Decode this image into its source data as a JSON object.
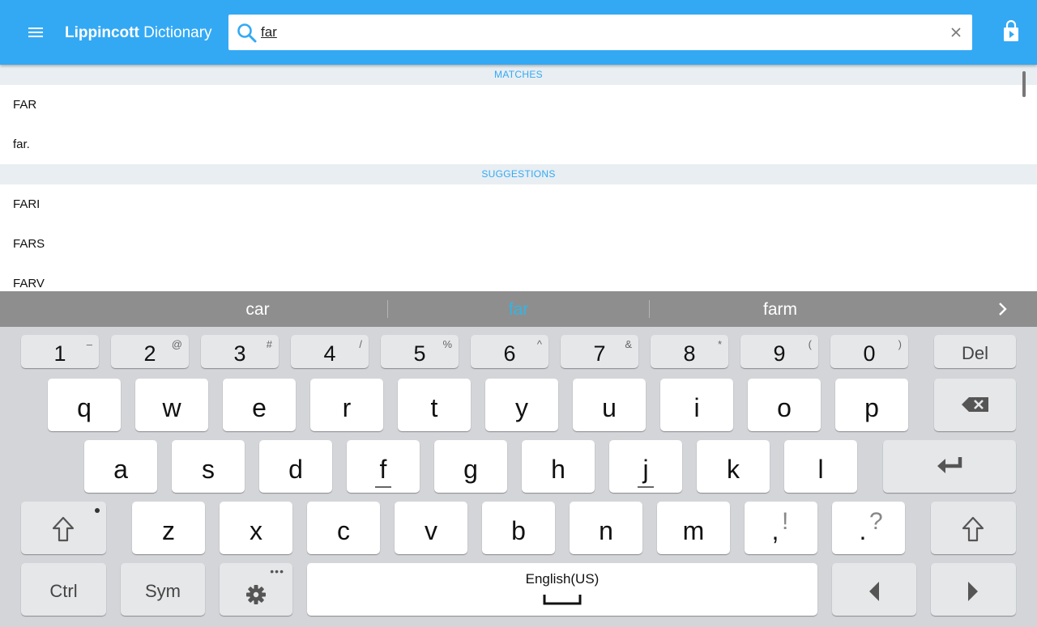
{
  "app": {
    "title_bold": "Lippincott",
    "title_regular": " Dictionary"
  },
  "search": {
    "value": "far",
    "placeholder": ""
  },
  "colors": {
    "appbar": "#33a9f4",
    "accent": "#33a9f4",
    "section_bg": "#e8eef2",
    "suggest_bg": "#8e8e8e",
    "suggest_active": "#33b5e5",
    "keyboard_bg": "#d3d5d9"
  },
  "icons": {
    "menu": "menu-icon",
    "search": "search-icon",
    "clear": "close-icon",
    "store": "store-bag-icon",
    "suggest_more": "chevron-right-icon"
  },
  "results": {
    "matches_header": "MATCHES",
    "matches": [
      "FAR",
      "far."
    ],
    "suggestions_header": "SUGGESTIONS",
    "suggestions": [
      "FARI",
      "FARS",
      "FARV"
    ]
  },
  "keyboard": {
    "suggestions": [
      "car",
      "far",
      "farm"
    ],
    "active_suggestion": "far",
    "number_row": [
      {
        "main": "1",
        "alt": "–"
      },
      {
        "main": "2",
        "alt": "@"
      },
      {
        "main": "3",
        "alt": "#"
      },
      {
        "main": "4",
        "alt": "/"
      },
      {
        "main": "5",
        "alt": "%"
      },
      {
        "main": "6",
        "alt": "^"
      },
      {
        "main": "7",
        "alt": "&"
      },
      {
        "main": "8",
        "alt": "*"
      },
      {
        "main": "9",
        "alt": "("
      },
      {
        "main": "0",
        "alt": ")"
      }
    ],
    "del_label": "Del",
    "row1": [
      "q",
      "w",
      "e",
      "r",
      "t",
      "y",
      "u",
      "i",
      "o",
      "p"
    ],
    "row2": [
      "a",
      "s",
      "d",
      "f",
      "g",
      "h",
      "j",
      "k",
      "l"
    ],
    "row3": [
      "z",
      "x",
      "c",
      "v",
      "b",
      "n",
      "m"
    ],
    "comma": {
      "main": ",",
      "alt": "!"
    },
    "period": {
      "main": ".",
      "alt": "?"
    },
    "ctrl_label": "Ctrl",
    "sym_label": "Sym",
    "space_label": "English(US)",
    "key_icons": {
      "backspace": "backspace-icon",
      "enter": "enter-icon",
      "shift": "shift-icon",
      "settings": "gear-icon",
      "left": "arrow-left-icon",
      "right": "arrow-right-icon",
      "space": "space-bar-icon"
    }
  }
}
